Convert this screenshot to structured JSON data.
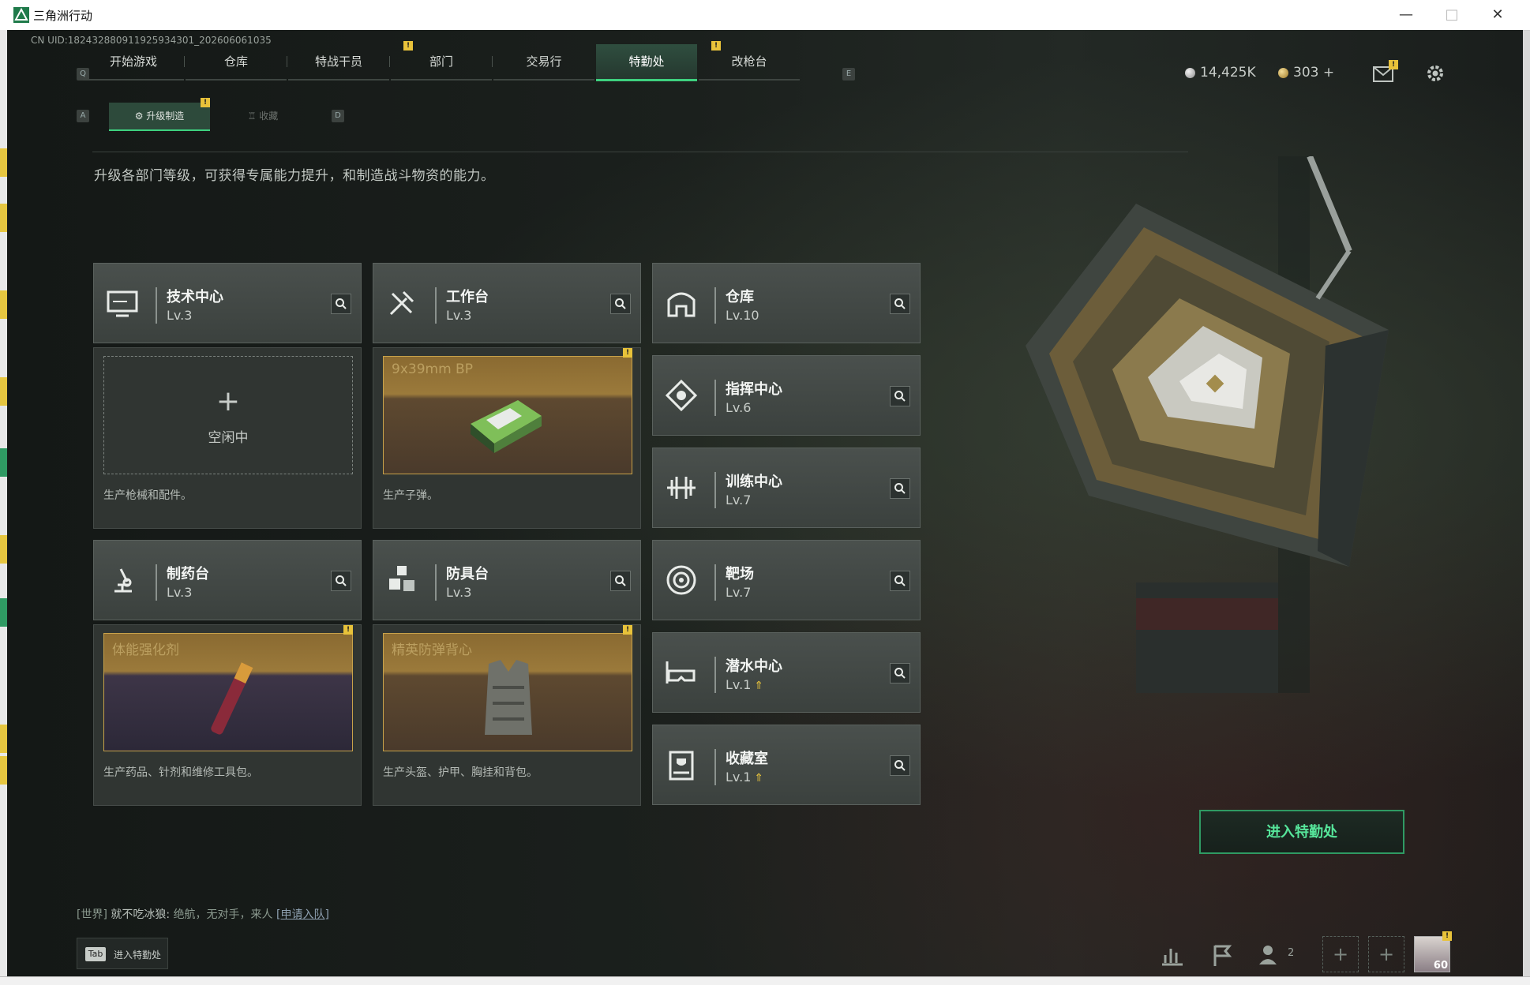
{
  "window": {
    "title": "三角洲行动",
    "minimize": "—",
    "maximize": "□",
    "close": "✕"
  },
  "uid": "CN UID:182432880911925934301_202606061035",
  "nav": {
    "left_key": "Q",
    "right_key": "E",
    "tabs": [
      {
        "label": "开始游戏"
      },
      {
        "label": "仓库"
      },
      {
        "label": "特战干员",
        "badge": "!"
      },
      {
        "label": "部门"
      },
      {
        "label": "交易行"
      },
      {
        "label": "特勤处",
        "badge": "!",
        "active": true
      },
      {
        "label": "改枪台"
      }
    ]
  },
  "subnav": {
    "left_key": "A",
    "right_key": "D",
    "tabs": [
      {
        "label": "升级制造",
        "active": true,
        "badge": "!"
      },
      {
        "label": "收藏"
      }
    ]
  },
  "currency": {
    "silver": "14,425K",
    "gold": "303",
    "add": "+"
  },
  "header_badges": {
    "mail": "!"
  },
  "description": "升级各部门等级，可获得专属能力提升，和制造战斗物资的能力。",
  "facilities": [
    {
      "name": "技术中心",
      "level": "Lv.3",
      "icon": "computer-icon"
    },
    {
      "name": "工作台",
      "level": "Lv.3",
      "icon": "tools-icon"
    },
    {
      "name": "仓库",
      "level": "Lv.10",
      "icon": "warehouse-icon"
    },
    {
      "name": "指挥中心",
      "level": "Lv.6",
      "icon": "command-icon"
    },
    {
      "name": "训练中心",
      "level": "Lv.7",
      "icon": "dumbbell-icon"
    },
    {
      "name": "制药台",
      "level": "Lv.3",
      "icon": "microscope-icon"
    },
    {
      "name": "防具台",
      "level": "Lv.3",
      "icon": "cubes-icon"
    },
    {
      "name": "靶场",
      "level": "Lv.7",
      "icon": "target-icon"
    },
    {
      "name": "潜水中心",
      "level": "Lv.1",
      "icon": "diving-mask-icon",
      "upgrade": true
    },
    {
      "name": "收藏室",
      "level": "Lv.1",
      "icon": "trophy-case-icon",
      "upgrade": true
    }
  ],
  "production": [
    {
      "slot": "tech",
      "idle": true,
      "idle_label": "空闲中",
      "plus": "+",
      "desc": "生产枪械和配件。"
    },
    {
      "slot": "workbench",
      "item": "9x39mm BP",
      "badge": "!",
      "desc": "生产子弹。"
    },
    {
      "slot": "pharmacy",
      "item": "体能强化剂",
      "badge": "!",
      "desc": "生产药品、针剂和维修工具包。"
    },
    {
      "slot": "armor",
      "item": "精英防弹背心",
      "badge": "!",
      "desc": "生产头盔、护甲、胸挂和背包。"
    }
  ],
  "enter_button": "进入特勤处",
  "chat": {
    "channel": "[世界]",
    "user": "就不吃冰狼:",
    "message": "绝航，无对手，来人",
    "link": "[申请入队]"
  },
  "tab_hint": {
    "key": "Tab",
    "label": "进入特勤处"
  },
  "bottom_bar": {
    "friends_count": "2",
    "slot_plus": "+",
    "avatar_level": "60",
    "avatar_badge": "!"
  },
  "colors": {
    "accent": "#3ed17f",
    "badge": "#e8c23a",
    "panel": "#3b413e"
  }
}
